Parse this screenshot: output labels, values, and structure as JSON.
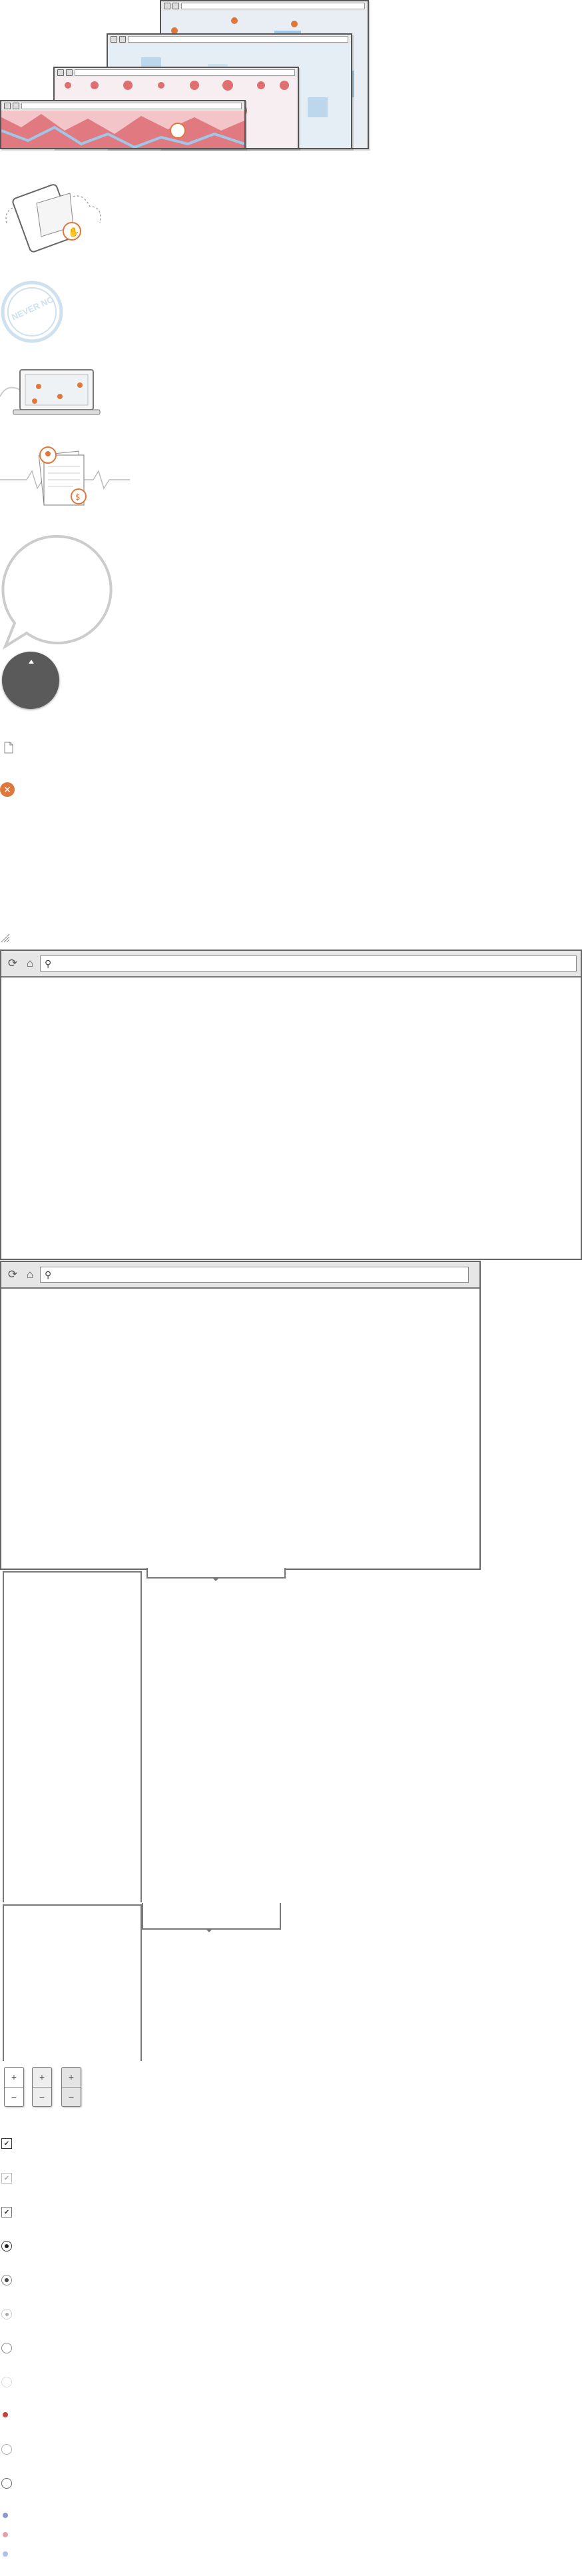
{
  "palette": {
    "accent": "#e0773a",
    "map_red": "#e07070",
    "map_blue": "#8fbfe0",
    "frame": "#555555",
    "toolbar": "#e6e6e6",
    "stamp": "#cfe0ee",
    "dark_circle": "#5a5a5a"
  },
  "stamp": {
    "text": "NEVER NO"
  },
  "browser_large": {
    "reload_icon": "reload-icon",
    "home_icon": "home-icon",
    "search_icon": "search-icon",
    "url": ""
  },
  "browser_medium": {
    "reload_icon": "reload-icon",
    "home_icon": "home-icon",
    "search_icon": "search-icon",
    "url": ""
  },
  "zoom_controls": [
    {
      "plus": "+",
      "minus": "−"
    },
    {
      "plus": "+",
      "minus": "−"
    },
    {
      "plus": "+",
      "minus": "−"
    }
  ],
  "form_controls": [
    {
      "type": "checkbox",
      "state": "checked"
    },
    {
      "type": "checkbox",
      "state": "checked-light"
    },
    {
      "type": "checkbox",
      "state": "checked"
    },
    {
      "type": "radio",
      "state": "selected-dark"
    },
    {
      "type": "radio",
      "state": "selected"
    },
    {
      "type": "radio",
      "state": "selected-light"
    },
    {
      "type": "radio",
      "state": "empty"
    },
    {
      "type": "radio",
      "state": "empty-light"
    },
    {
      "type": "dot",
      "state": "red"
    },
    {
      "type": "radio",
      "state": "empty"
    },
    {
      "type": "radio",
      "state": "empty"
    },
    {
      "type": "dot",
      "state": "blue"
    },
    {
      "type": "dot",
      "state": "pink"
    },
    {
      "type": "dot",
      "state": "light-blue"
    }
  ]
}
